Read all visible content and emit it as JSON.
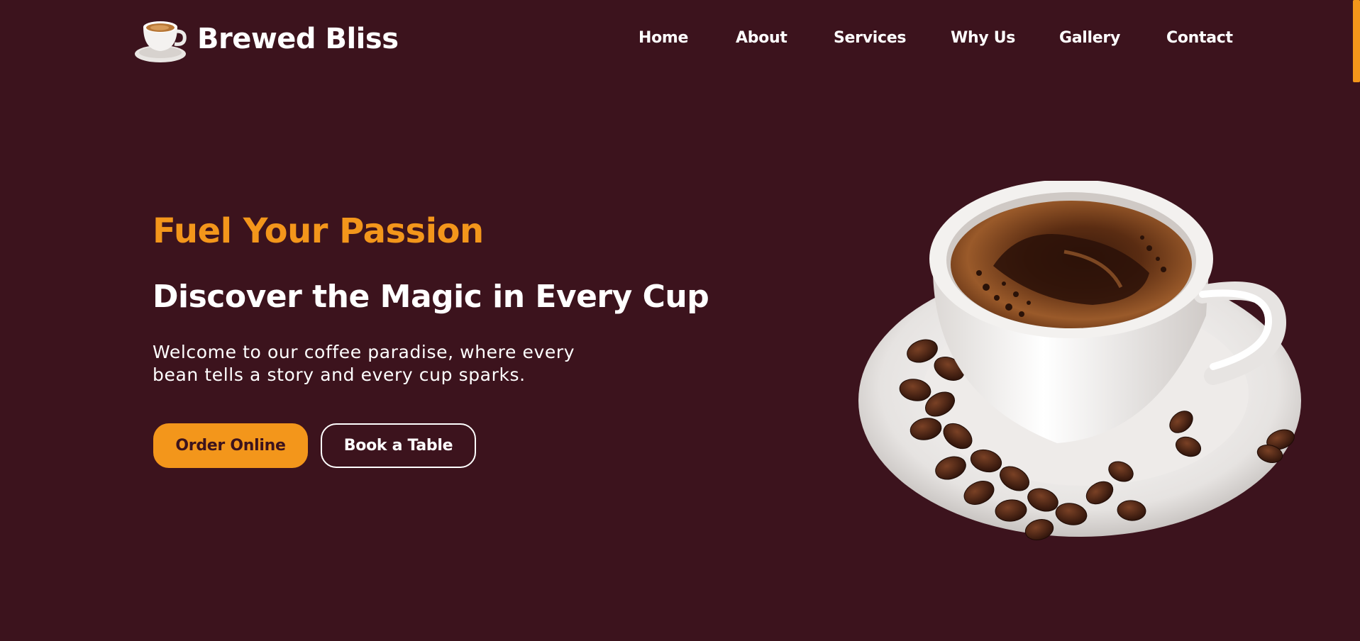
{
  "brand": {
    "name": "Brewed Bliss",
    "logo_icon": "coffee-cup-icon"
  },
  "nav": {
    "items": [
      {
        "label": "Home"
      },
      {
        "label": "About"
      },
      {
        "label": "Services"
      },
      {
        "label": "Why Us"
      },
      {
        "label": "Gallery"
      },
      {
        "label": "Contact"
      }
    ]
  },
  "hero": {
    "tagline": "Fuel Your Passion",
    "headline": "Discover the Magic in Every Cup",
    "description": "Welcome to our coffee paradise, where every bean tells a story and every cup sparks.",
    "primary_button": "Order Online",
    "secondary_button": "Book a Table",
    "image_icon": "coffee-cup-with-beans-image"
  },
  "colors": {
    "background": "#3c131d",
    "accent": "#f3961b",
    "text": "#ffffff"
  }
}
